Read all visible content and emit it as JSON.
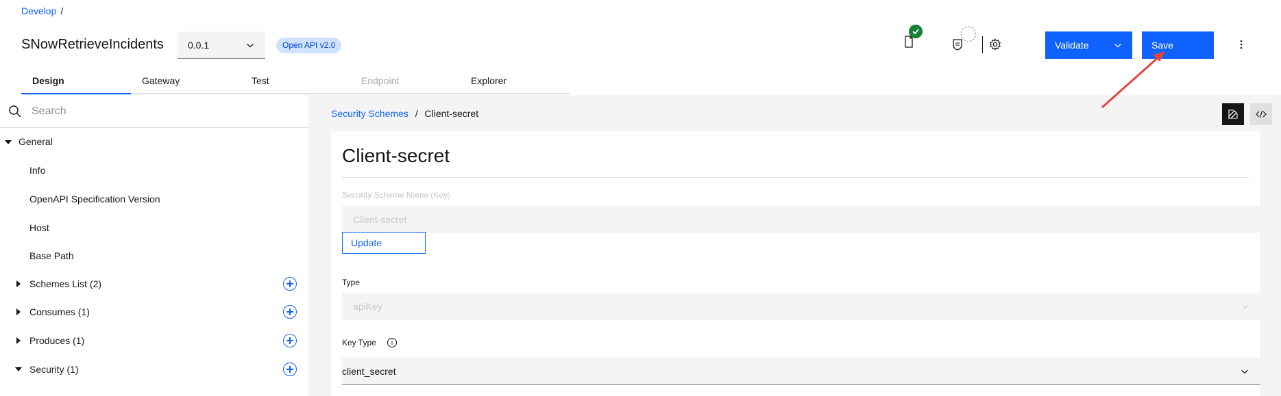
{
  "breadcrumb": {
    "root": "Develop",
    "separator": "/"
  },
  "api": {
    "title": "SNowRetrieveIncidents",
    "version": "0.0.1",
    "spec_tag": "Open API v2.0"
  },
  "actions": {
    "validate_label": "Validate",
    "save_label": "Save"
  },
  "tabs": [
    {
      "label": "Design"
    },
    {
      "label": "Gateway"
    },
    {
      "label": "Test"
    },
    {
      "label": "Endpoint"
    },
    {
      "label": "Explorer"
    }
  ],
  "sidebar": {
    "search_placeholder": "Search",
    "general_label": "General",
    "items": [
      {
        "label": "Info"
      },
      {
        "label": "OpenAPI Specification Version"
      },
      {
        "label": "Host"
      },
      {
        "label": "Base Path"
      },
      {
        "label": "Schemes List (2)"
      },
      {
        "label": "Consumes (1)"
      },
      {
        "label": "Produces (1)"
      },
      {
        "label": "Security (1)"
      }
    ]
  },
  "main": {
    "breadcrumb_parent": "Security Schemes",
    "breadcrumb_separator": "/",
    "breadcrumb_current": "Client-secret",
    "card_title": "Client-secret",
    "scheme_name_label": "Security Scheme Name (Key)",
    "scheme_name_value": "Client-secret",
    "update_label": "Update",
    "type_label": "Type",
    "type_value": "apiKey",
    "key_type_label": "Key Type",
    "key_type_value": "client_secret"
  },
  "colors": {
    "accent": "#0f62fe",
    "success": "#198038",
    "annotation_arrow": "#e8433a"
  }
}
